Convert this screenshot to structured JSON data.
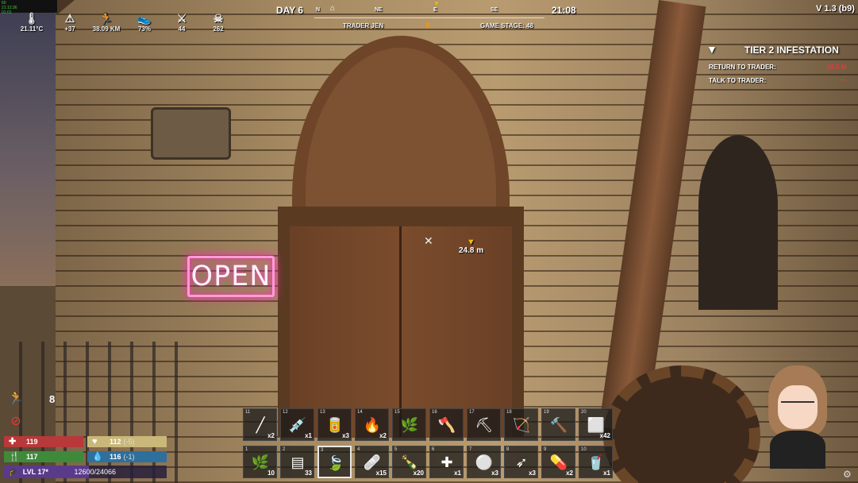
{
  "fps_overlay": [
    "60",
    "21:12:36",
    "01:01"
  ],
  "top_stats": [
    {
      "icon": "thermometer-icon",
      "glyph": "🌡",
      "value": "21.11°C"
    },
    {
      "icon": "hazard-icon",
      "glyph": "⚠",
      "value": "+37"
    },
    {
      "icon": "running-icon",
      "glyph": "🏃",
      "value": "38.09 KM"
    },
    {
      "icon": "shoe-icon",
      "glyph": "👟",
      "value": "73%"
    },
    {
      "icon": "zombie-kills-icon",
      "glyph": "⚔",
      "value": "44"
    },
    {
      "icon": "skull-icon",
      "glyph": "☠",
      "value": "262"
    }
  ],
  "hud": {
    "day": "DAY 6",
    "time": "21:08",
    "version": "V 1.3 (b9)",
    "trader_name": "TRADER JEN",
    "game_stage": "GAME STAGE: 48",
    "compass": [
      "N",
      "NE",
      "E",
      "SE"
    ]
  },
  "quest": {
    "title": "TIER 2 INFESTATION",
    "lines": [
      {
        "label": "RETURN TO TRADER:",
        "value": "26.5 M"
      },
      {
        "label": "TALK TO TRADER:",
        "value": "—"
      }
    ]
  },
  "scene": {
    "sign_text": "OPEN",
    "marker_distance": "24.8 m"
  },
  "status": {
    "buff_count": "8",
    "health": "119",
    "stamina": "112",
    "stamina_mod": "(-5)",
    "food": "117",
    "water": "116",
    "water_mod": "(-1)",
    "level": "LVL 17*",
    "xp": "12600/24066",
    "xp_fraction": 0.52
  },
  "colors": {
    "health": "#b73939",
    "stamina": "#c9b87a",
    "food": "#3f8a3a",
    "water": "#2f6f9c",
    "accent": "#f2b814"
  },
  "toolbelt": {
    "top_row": [
      {
        "num": "11",
        "count": "x2",
        "icon": "pipe-icon",
        "glyph": "╱"
      },
      {
        "num": "12",
        "count": "x1",
        "icon": "syringe-icon",
        "glyph": "💉"
      },
      {
        "num": "13",
        "count": "x3",
        "icon": "can-icon",
        "glyph": "🥫"
      },
      {
        "num": "14",
        "count": "x2",
        "icon": "torch-icon",
        "glyph": "🔥"
      },
      {
        "num": "15",
        "count": "",
        "icon": "plant-fiber-icon",
        "glyph": "🌿"
      },
      {
        "num": "16",
        "count": "",
        "icon": "axe-icon",
        "glyph": "🪓"
      },
      {
        "num": "17",
        "count": "",
        "icon": "pickaxe-icon",
        "glyph": "⛏"
      },
      {
        "num": "18",
        "count": "",
        "icon": "bow-icon",
        "glyph": "🏹"
      },
      {
        "num": "19",
        "count": "",
        "icon": "hammer-icon",
        "glyph": "🔨"
      },
      {
        "num": "20",
        "count": "x42",
        "icon": "block-icon",
        "glyph": "⬜"
      }
    ],
    "bottom_row": [
      {
        "num": "1",
        "count": "10",
        "icon": "leaves-icon",
        "glyph": "🌿"
      },
      {
        "num": "2",
        "count": "33",
        "icon": "ammo-icon",
        "glyph": "▤"
      },
      {
        "num": "3",
        "count": "",
        "icon": "leaves-icon",
        "glyph": "🍃",
        "selected": true
      },
      {
        "num": "4",
        "count": "x15",
        "icon": "bandage-icon",
        "glyph": "🩹"
      },
      {
        "num": "5",
        "count": "x20",
        "icon": "bottle-icon",
        "glyph": "🍾"
      },
      {
        "num": "6",
        "count": "x1",
        "icon": "first-aid-icon",
        "glyph": "✚"
      },
      {
        "num": "7",
        "count": "x3",
        "icon": "plate-icon",
        "glyph": "⚪"
      },
      {
        "num": "8",
        "count": "x3",
        "icon": "arrows-icon",
        "glyph": "➶"
      },
      {
        "num": "9",
        "count": "x2",
        "icon": "pill-icon",
        "glyph": "💊"
      },
      {
        "num": "10",
        "count": "x1",
        "icon": "drink-icon",
        "glyph": "🥤"
      }
    ]
  }
}
